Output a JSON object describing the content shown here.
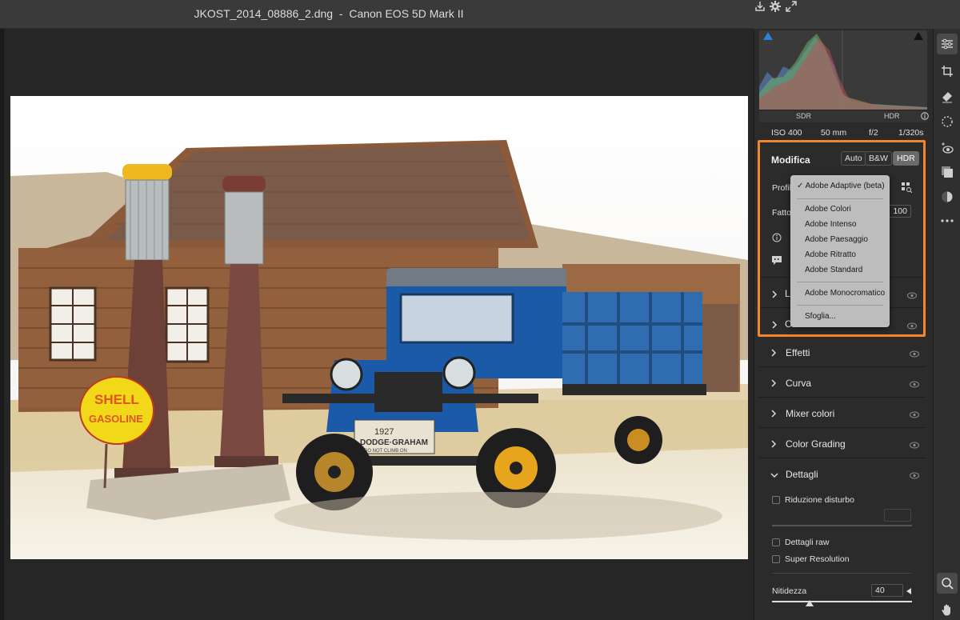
{
  "titlebar": {
    "filename": "JKOST_2014_08886_2.dng",
    "separator": "-",
    "camera": "Canon EOS 5D Mark II"
  },
  "histogram": {
    "sdr_label": "SDR",
    "hdr_label": "HDR"
  },
  "exif": {
    "iso": "ISO 400",
    "focal": "50 mm",
    "aperture": "f/2",
    "shutter": "1/320s"
  },
  "edit": {
    "title": "Modifica",
    "auto_label": "Auto",
    "bw_label": "B&W",
    "hdr_label": "HDR",
    "profile_label": "Profilo",
    "factor_label": "Fattore",
    "factor_value": "100",
    "light_label": "Luce",
    "color_label": "Colore"
  },
  "profile_menu": {
    "items": [
      {
        "label": "Adobe Adaptive (beta)",
        "checked": true
      },
      {
        "label": "Adobe Colori"
      },
      {
        "label": "Adobe Intenso"
      },
      {
        "label": "Adobe Paesaggio"
      },
      {
        "label": "Adobe Ritratto"
      },
      {
        "label": "Adobe Standard"
      },
      {
        "label": "Adobe Monocromatico"
      },
      {
        "label": "Sfoglia..."
      }
    ]
  },
  "sections": {
    "effects": "Effetti",
    "curve": "Curva",
    "mixer": "Mixer colori",
    "grading": "Color Grading",
    "details": "Dettagli"
  },
  "details": {
    "noise_reduction": "Riduzione disturbo",
    "raw_details": "Dettagli raw",
    "super_resolution": "Super Resolution",
    "sharpening_label": "Nitidezza",
    "sharpening_value": "40",
    "sharpening_level": 0.27
  },
  "colors": {
    "accent": "#f2862b",
    "panel_bg": "#2b2b2b",
    "canvas_bg": "#262626"
  },
  "icons": {
    "export": "export-icon",
    "settings": "gear-icon",
    "fullscreen": "expand-icon"
  }
}
